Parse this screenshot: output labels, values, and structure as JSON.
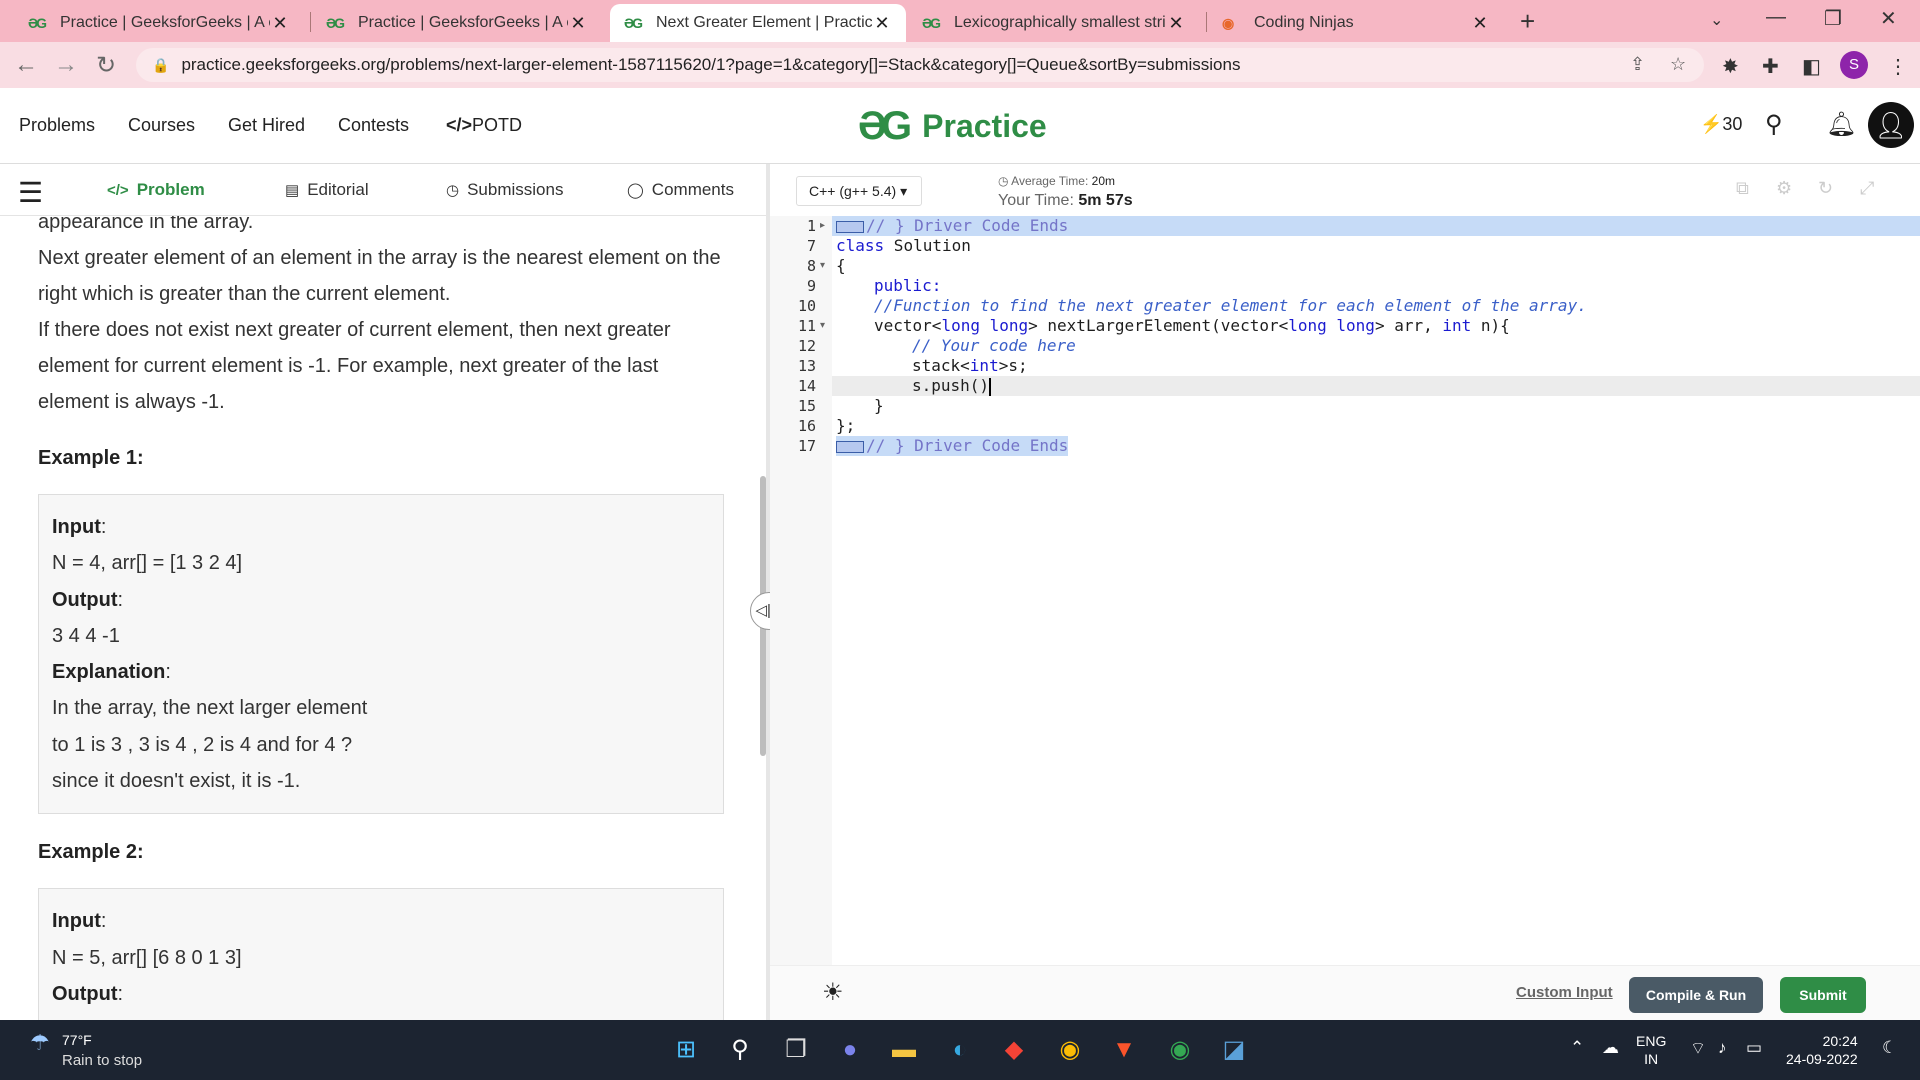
{
  "browser": {
    "tabs": [
      {
        "title": "Practice | GeeksforGeeks | A com",
        "favicon": "gfg-logo-icon"
      },
      {
        "title": "Practice | GeeksforGeeks | A com",
        "favicon": "gfg-logo-icon"
      },
      {
        "title": "Next Greater Element | Practice |",
        "favicon": "gfg-logo-icon"
      },
      {
        "title": "Lexicographically smallest string",
        "favicon": "gfg-logo-icon"
      },
      {
        "title": "Coding Ninjas",
        "favicon": "coding-ninjas-icon"
      }
    ],
    "active_tab": 2,
    "url": "practice.geeksforgeeks.org/problems/next-larger-element-1587115620/1?page=1&category[]=Stack&category[]=Queue&sortBy=submissions",
    "profile_initial": "S"
  },
  "header": {
    "nav": [
      "Problems",
      "Courses",
      "Get Hired",
      "Contests",
      "POTD"
    ],
    "potd_prefix": "</>",
    "logo_mark": "ƏG",
    "logo_word": "Practice",
    "streak": "30"
  },
  "problem_tabs": [
    {
      "label": "Problem",
      "icon": "</>"
    },
    {
      "label": "Editorial",
      "icon": "▤"
    },
    {
      "label": "Submissions",
      "icon": "◷"
    },
    {
      "label": "Comments",
      "icon": "◯"
    }
  ],
  "problem": {
    "partial_line": "appearance in the array.",
    "p1": "Next greater element of an element in the array is the nearest element on the right which is greater than the current element.",
    "p2": "If there does not exist next greater of current element, then next greater element for current element is -1. For example, next greater of the last element is always -1.",
    "examples": [
      {
        "heading": "Example 1:",
        "input_label": "Input",
        "input": "N = 4, arr[] = [1 3 2 4]",
        "output_label": "Output",
        "output": "3 4 4 -1",
        "explanation_label": "Explanation",
        "explanation_lines": [
          "In the array, the next larger element",
          "to 1 is 3 , 3 is 4 , 2 is 4 and for 4 ?",
          "since it doesn't exist, it is -1."
        ]
      },
      {
        "heading": "Example 2:",
        "input_label": "Input",
        "input": "N = 5, arr[] [6 8 0 1 3]",
        "output_label": "Output"
      }
    ]
  },
  "editor": {
    "language": "C++ (g++ 5.4)",
    "average_time_label": "Average Time:",
    "average_time": "20m",
    "your_time_label": "Your Time:",
    "your_time": "5m 57s",
    "line_numbers": [
      "1",
      "7",
      "8",
      "9",
      "10",
      "11",
      "12",
      "13",
      "14",
      "15",
      "16",
      "17"
    ],
    "code": {
      "l1": "// } Driver Code Ends",
      "l7_kw": "class",
      "l7": " Solution",
      "l8": "{",
      "l9": "public:",
      "l10": "//Function to find the next greater element for each element of the array.",
      "l11_a": "vector<",
      "l11_b": "long long",
      "l11_c": "> nextLargerElement(vector<",
      "l11_d": "long long",
      "l11_e": "> arr, ",
      "l11_f": "int",
      "l11_g": " n){",
      "l12": "// Your code here",
      "l13_a": "stack<",
      "l13_b": "int",
      "l13_c": ">s;",
      "l14": "s.push()",
      "l15": "}",
      "l16": "};",
      "l17": "// } Driver Code Ends"
    },
    "custom_input": "Custom Input",
    "compile_run": "Compile & Run",
    "submit": "Submit"
  },
  "taskbar": {
    "temp": "77°F",
    "weather_desc": "Rain to stop",
    "lang_line1": "ENG",
    "lang_line2": "IN",
    "time": "20:24",
    "date": "24-09-2022"
  }
}
